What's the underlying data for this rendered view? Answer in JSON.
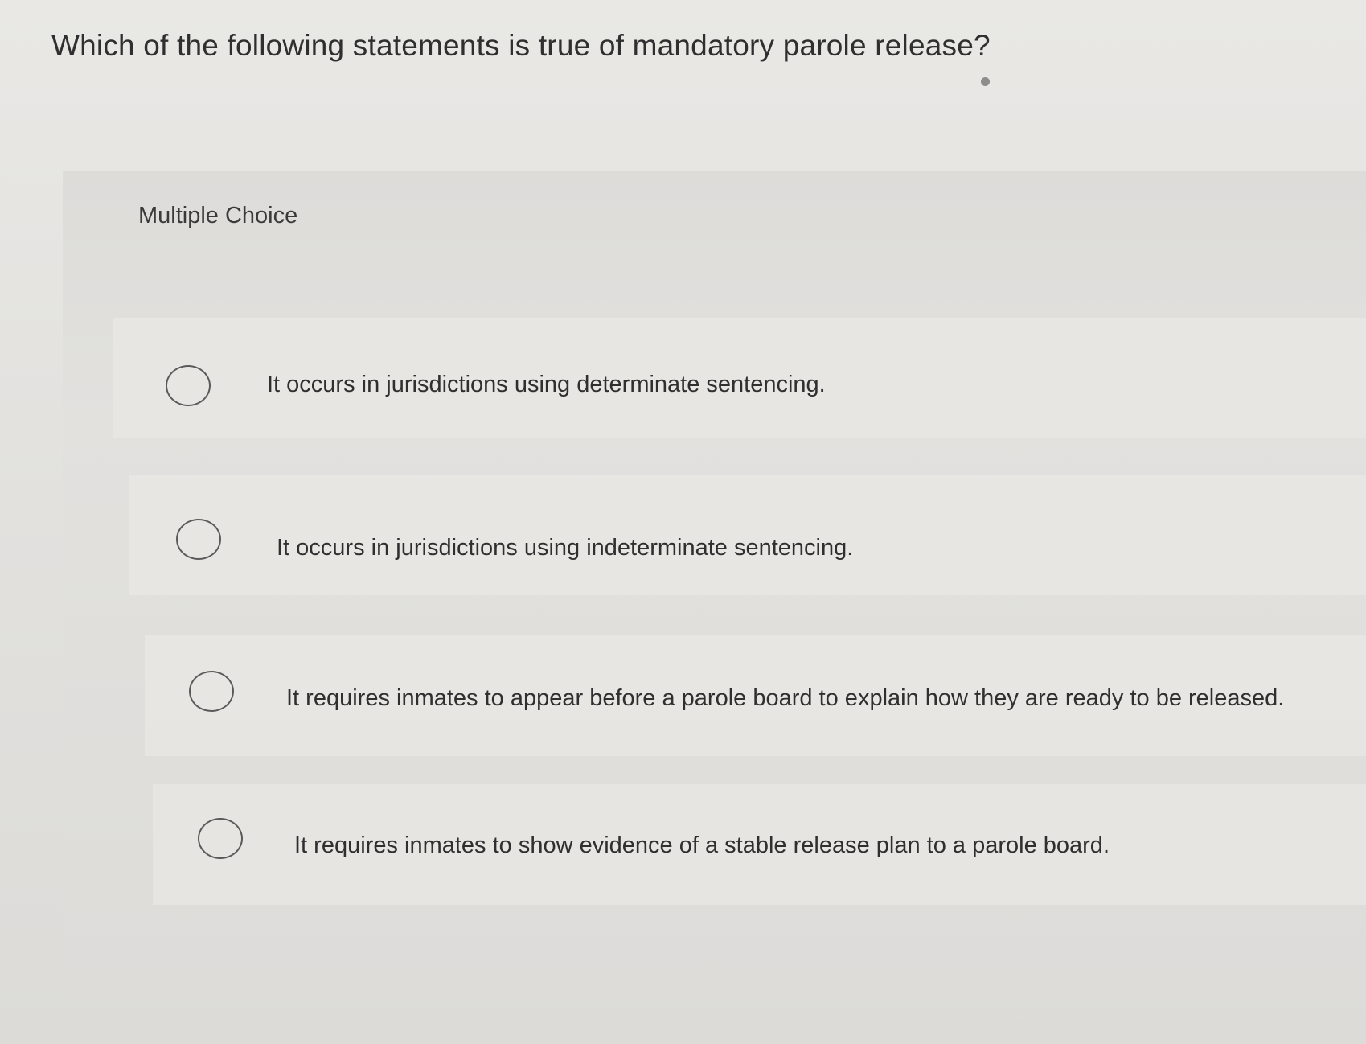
{
  "question": {
    "text": "Which of the following statements is true of mandatory parole release?"
  },
  "section": {
    "label": "Multiple Choice"
  },
  "options": [
    {
      "text": "It occurs in jurisdictions using determinate sentencing.",
      "selected": false
    },
    {
      "text": "It occurs in jurisdictions using indeterminate sentencing.",
      "selected": false
    },
    {
      "text": "It requires inmates to appear before a parole board to explain how they are ready to be released.",
      "selected": false
    },
    {
      "text": "It requires inmates to show evidence of a stable release plan to a parole board.",
      "selected": false
    }
  ]
}
